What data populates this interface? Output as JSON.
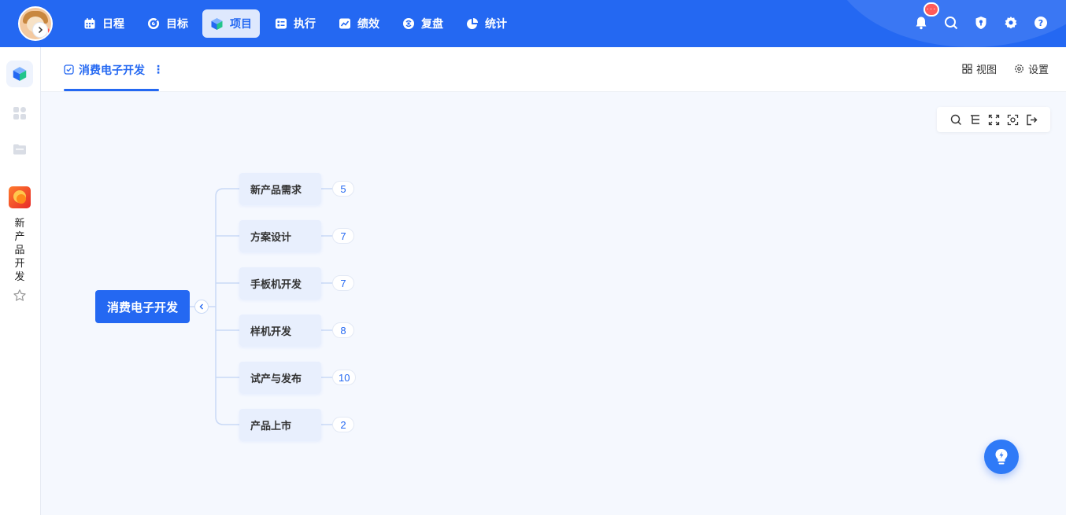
{
  "nav": {
    "items": [
      {
        "label": "日程",
        "icon": "calendar-icon"
      },
      {
        "label": "目标",
        "icon": "target-icon"
      },
      {
        "label": "项目",
        "icon": "cube-icon",
        "active": true
      },
      {
        "label": "执行",
        "icon": "checklist-icon"
      },
      {
        "label": "绩效",
        "icon": "chart-icon"
      },
      {
        "label": "复盘",
        "icon": "review-icon"
      },
      {
        "label": "统计",
        "icon": "pie-icon"
      }
    ],
    "notification_badge": "···"
  },
  "sidebar": {
    "project_name": [
      "新",
      "产",
      "品",
      "开",
      "发"
    ]
  },
  "tab": {
    "label": "消费电子开发",
    "more": "⋮"
  },
  "tab_actions": {
    "view_label": "视图",
    "settings_label": "设置"
  },
  "mindmap": {
    "root": "消费电子开发",
    "children": [
      {
        "label": "新产品需求",
        "count": "5"
      },
      {
        "label": "方案设计",
        "count": "7"
      },
      {
        "label": "手板机开发",
        "count": "7"
      },
      {
        "label": "样机开发",
        "count": "8"
      },
      {
        "label": "试产与发布",
        "count": "10"
      },
      {
        "label": "产品上市",
        "count": "2"
      }
    ]
  },
  "colors": {
    "accent": "#2468f2",
    "node_bg": "#e8effd",
    "canvas_bg": "#f5f8fe"
  }
}
